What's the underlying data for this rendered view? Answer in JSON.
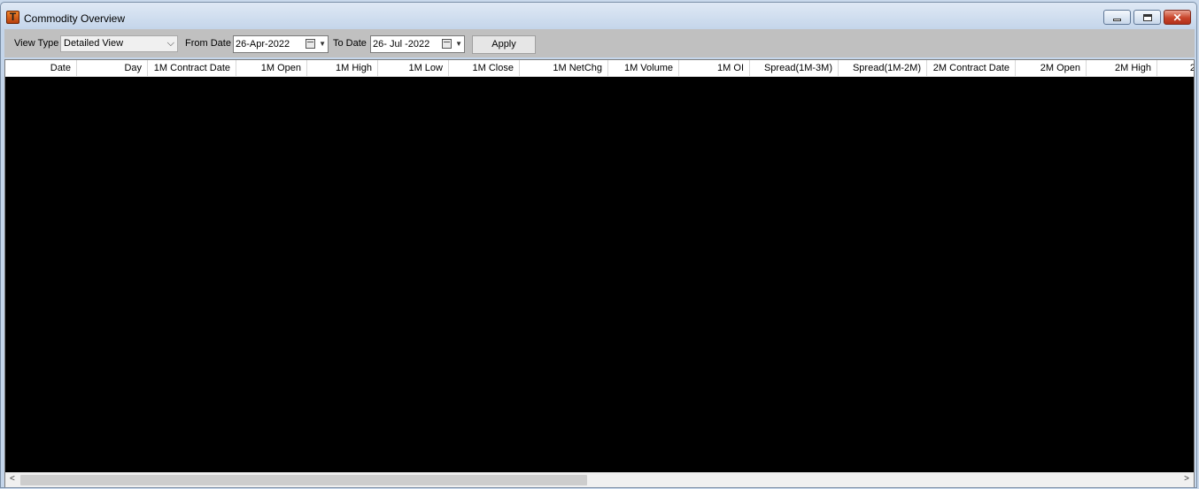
{
  "window": {
    "title": "Commodity Overview",
    "app_icon_letter": "T"
  },
  "toolbar": {
    "view_type_label": "View Type",
    "view_type_value": "Detailed View",
    "from_date_label": "From Date",
    "from_date_value": "26-Apr-2022",
    "to_date_label": "To Date",
    "to_date_value": "26- Jul -2022",
    "apply_label": "Apply"
  },
  "grid": {
    "columns": [
      "Date",
      "Day",
      "1M Contract Date",
      "1M Open",
      "1M High",
      "1M Low",
      "1M Close",
      "1M NetChg",
      "1M Volume",
      "1M OI",
      "Spread(1M-3M)",
      "Spread(1M-2M)",
      "2M Contract Date",
      "2M Open",
      "2M High",
      "2"
    ]
  },
  "colors": {
    "grid_background": "#000000",
    "toolbar_background": "#c0c0c0"
  }
}
